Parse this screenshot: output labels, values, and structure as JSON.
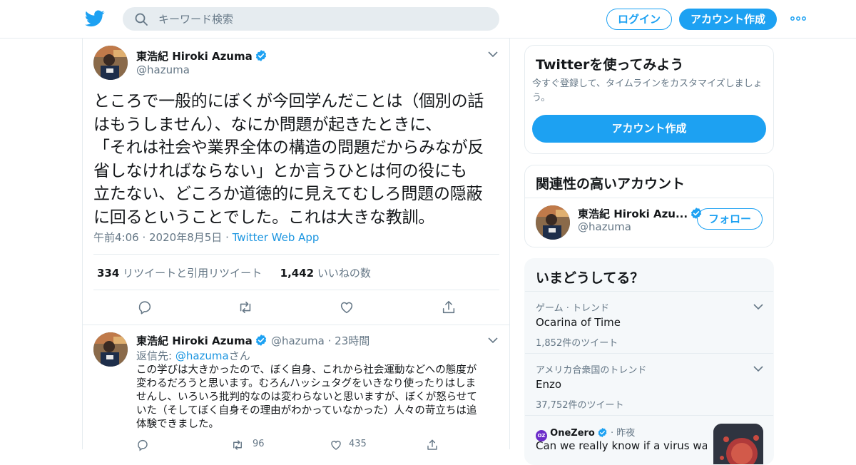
{
  "topbar": {
    "search_placeholder": "キーワード検索",
    "login_label": "ログイン",
    "signup_label": "アカウント作成"
  },
  "tweet": {
    "display_name": "東浩紀 Hiroki Azuma",
    "handle": "@hazuma",
    "lines": [
      "ところで一般的にぼくが今回学んだことは（個別の話",
      "はもうしません）、なにか問題が起きたときに、",
      "「それは社会や業界全体の構造の問題だからみなが反",
      "省しなければならない」とか言うひとは何の役にも",
      "立たない、どころか道徳的に見えてむしろ問題の隠蔽",
      "に回るということでした。これは大きな教訓。"
    ],
    "time": "午前4:06",
    "date": "2020年8月5日",
    "source": "Twitter Web App",
    "retweet_count": "334",
    "retweet_label": "リツイートと引用リツイート",
    "like_count": "1,442",
    "like_label": "いいねの数"
  },
  "reply": {
    "display_name": "東浩紀 Hiroki Azuma",
    "handle": "@hazuma",
    "age": "23時間",
    "reply_prefix": "返信先: ",
    "reply_to": "@hazuma",
    "reply_suffix": "さん",
    "lines": [
      "この学びは大きかったので、ぼく自身、これから社会運動などへの態度が",
      "変わるだろうと思います。むろんハッシュタグをいきなり使ったりはしま",
      "せんし、いろいろ批判的なのは変わらないと思いますが、ぼくが怒らせて",
      "いた（そしてぼく自身その理由がわかっていなかった）人々の苛立ちは追",
      "体験できました。"
    ],
    "retweets": "96",
    "likes": "435"
  },
  "signup_card": {
    "title": "Twitterを使ってみよう",
    "subtitle": "今すぐ登録して、タイムラインをカスタマイズしましょう。",
    "button": "アカウント作成"
  },
  "related": {
    "title": "関連性の高いアカウント",
    "name": "東浩紀 Hiroki Azu...",
    "handle": "@hazuma",
    "follow": "フォロー"
  },
  "trends": {
    "title": "いまどうしてる？",
    "items": [
      {
        "category": "ゲーム · トレンド",
        "name": "Ocarina of Time",
        "count": "1,852件のツイート"
      },
      {
        "category": "アメリカ合衆国のトレンド",
        "name": "Enzo",
        "count": "37,752件のツイート"
      }
    ],
    "news": {
      "source": "OneZero",
      "badge": "OZ",
      "age": "昨夜",
      "headline": "Can we really know if a virus was"
    }
  },
  "colors": {
    "accent": "#1da1f2",
    "link": "#1b95e0",
    "muted": "#657786"
  }
}
